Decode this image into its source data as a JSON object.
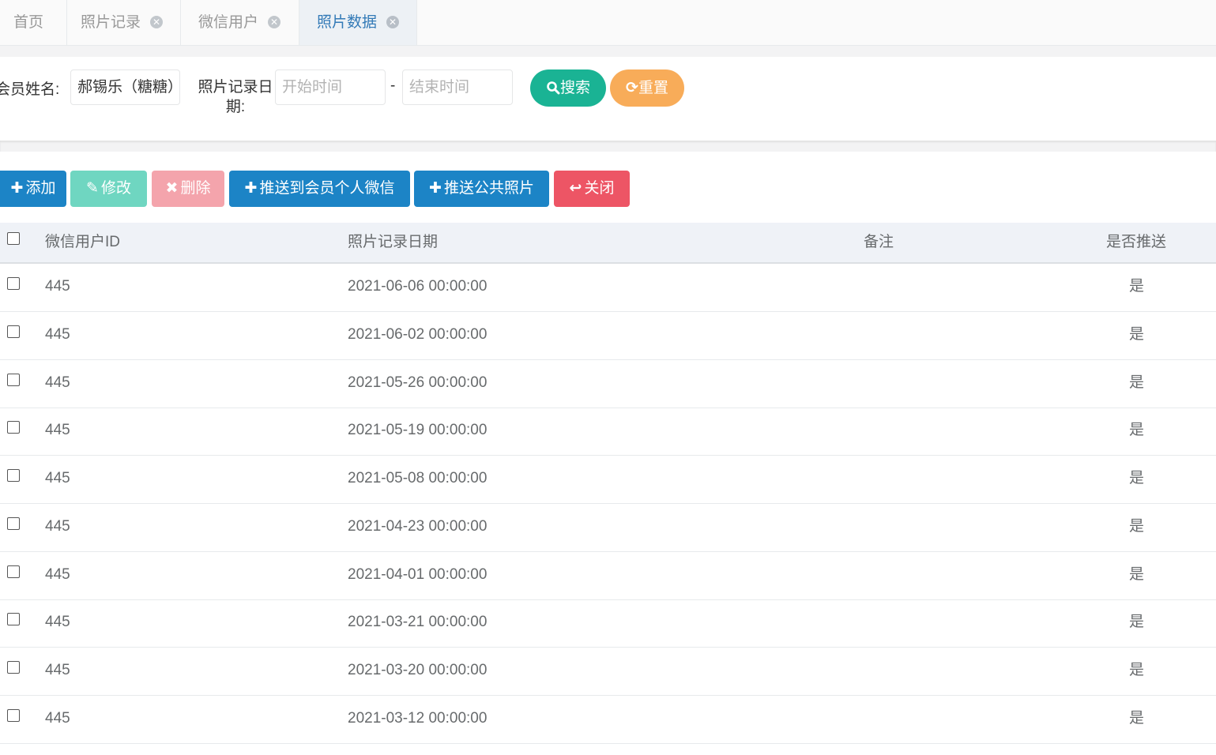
{
  "tabs": [
    {
      "label": "首页",
      "closable": false,
      "active": false
    },
    {
      "label": "照片记录",
      "closable": true,
      "active": false
    },
    {
      "label": "微信用户",
      "closable": true,
      "active": false
    },
    {
      "label": "照片数据",
      "closable": true,
      "active": true
    }
  ],
  "search": {
    "member_label": "会员姓名:",
    "member_value": "郝锡乐（糖糖）",
    "date_label": "照片记录日期:",
    "start_placeholder": "开始时间",
    "end_placeholder": "结束时间",
    "range_separator": "-",
    "search_label": "搜索",
    "reset_label": "重置"
  },
  "toolbar": {
    "add_label": "添加",
    "edit_label": "修改",
    "delete_label": "删除",
    "push_member_label": "推送到会员个人微信",
    "push_public_label": "推送公共照片",
    "close_label": "关闭"
  },
  "table": {
    "columns": [
      "微信用户ID",
      "照片记录日期",
      "备注",
      "是否推送"
    ],
    "rows": [
      {
        "wechat_id": "445",
        "date": "2021-06-06 00:00:00",
        "note": "",
        "pushed": "是"
      },
      {
        "wechat_id": "445",
        "date": "2021-06-02 00:00:00",
        "note": "",
        "pushed": "是"
      },
      {
        "wechat_id": "445",
        "date": "2021-05-26 00:00:00",
        "note": "",
        "pushed": "是"
      },
      {
        "wechat_id": "445",
        "date": "2021-05-19 00:00:00",
        "note": "",
        "pushed": "是"
      },
      {
        "wechat_id": "445",
        "date": "2021-05-08 00:00:00",
        "note": "",
        "pushed": "是"
      },
      {
        "wechat_id": "445",
        "date": "2021-04-23 00:00:00",
        "note": "",
        "pushed": "是"
      },
      {
        "wechat_id": "445",
        "date": "2021-04-01 00:00:00",
        "note": "",
        "pushed": "是"
      },
      {
        "wechat_id": "445",
        "date": "2021-03-21 00:00:00",
        "note": "",
        "pushed": "是"
      },
      {
        "wechat_id": "445",
        "date": "2021-03-20 00:00:00",
        "note": "",
        "pushed": "是"
      },
      {
        "wechat_id": "445",
        "date": "2021-03-12 00:00:00",
        "note": "",
        "pushed": "是"
      }
    ]
  },
  "colors": {
    "primary": "#1c84c6",
    "success": "#1ab394",
    "warning": "#f8ac59",
    "danger": "#ed5565",
    "edit_disabled": "#6fd6c1",
    "delete_disabled": "#f4a4ac"
  },
  "icons": {
    "close_tab": "close-circle-icon",
    "search": "search-icon",
    "reset": "refresh-icon",
    "add": "plus-icon",
    "edit": "edit-icon",
    "delete": "x-icon",
    "close": "reply-icon"
  }
}
